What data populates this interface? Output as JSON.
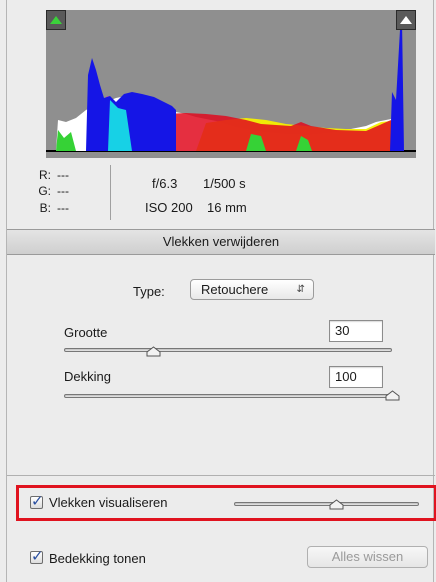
{
  "histogram": {
    "shadow_clip_icon": "triangle-up-icon",
    "highlight_clip_icon": "triangle-up-icon"
  },
  "readout": {
    "r_label": "R:",
    "r_value": "---",
    "g_label": "G:",
    "g_value": "---",
    "b_label": "B:",
    "b_value": "---",
    "aperture": "f/6.3",
    "shutter": "1/500 s",
    "iso": "ISO 200",
    "focal_length": "16 mm"
  },
  "section": {
    "title": "Vlekken verwijderen"
  },
  "type": {
    "label": "Type:",
    "selected": "Retouchere",
    "arrow_icon": "updown-arrows-icon"
  },
  "size": {
    "label": "Grootte",
    "value": "30",
    "slider_level": 0.27
  },
  "opacity": {
    "label": "Dekking",
    "value": "100",
    "slider_level": 1.0
  },
  "visualize": {
    "label": "Vlekken visualiseren",
    "checked": true,
    "slider_level": 0.55,
    "highlight_color": "#e0131f"
  },
  "overlay": {
    "label": "Bedekking tonen",
    "checked": true
  },
  "clear_button": {
    "label": "Alles wissen"
  }
}
